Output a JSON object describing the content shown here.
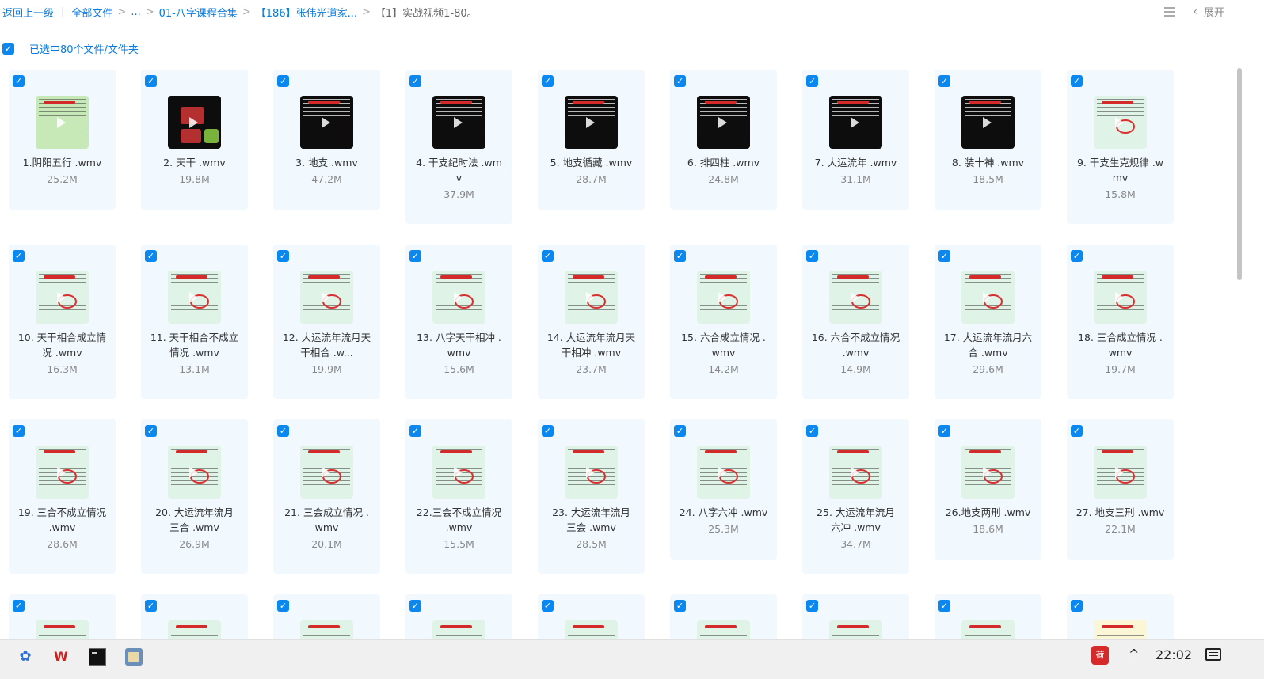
{
  "breadcrumb": {
    "back_label": "返回上一级",
    "items": [
      "全部文件",
      "...",
      "01-八字课程合集",
      "【186】张伟光道家...",
      "【1】实战视频1-80。"
    ],
    "separator": ">"
  },
  "topbar": {
    "expand_label": "展开",
    "list_view_icon": "list-view-icon",
    "collapse_icon": "chevron-left-icon"
  },
  "selection": {
    "label": "已选中80个文件/文件夹",
    "checked": true
  },
  "files": [
    {
      "name": "1.阴阳五行 .wmv",
      "size": "25.2M",
      "thumb": "greenbright"
    },
    {
      "name": "2. 天干 .wmv",
      "size": "19.8M",
      "thumb": "darkboxes"
    },
    {
      "name": "3. 地支 .wmv",
      "size": "47.2M",
      "thumb": "dark"
    },
    {
      "name": "4. 干支纪时法 .wmv",
      "size": "37.9M",
      "thumb": "dark"
    },
    {
      "name": "5. 地支循藏 .wmv",
      "size": "28.7M",
      "thumb": "dark"
    },
    {
      "name": "6. 排四柱 .wmv",
      "size": "24.8M",
      "thumb": "dark"
    },
    {
      "name": "7. 大运流年 .wmv",
      "size": "31.1M",
      "thumb": "dark"
    },
    {
      "name": "8. 装十神 .wmv",
      "size": "18.5M",
      "thumb": "dark"
    },
    {
      "name": "9. 干支生克规律 .wmv",
      "size": "15.8M",
      "thumb": "green"
    },
    {
      "name": "10. 天干相合成立情况 .wmv",
      "size": "16.3M",
      "thumb": "green"
    },
    {
      "name": "11. 天干相合不成立情况 .wmv",
      "size": "13.1M",
      "thumb": "green"
    },
    {
      "name": "12. 大运流年流月天干相合 .w...",
      "size": "19.9M",
      "thumb": "green"
    },
    {
      "name": "13. 八字天干相冲 .wmv",
      "size": "15.6M",
      "thumb": "green"
    },
    {
      "name": "14. 大运流年流月天干相冲 .wmv",
      "size": "23.7M",
      "thumb": "green"
    },
    {
      "name": "15. 六合成立情况 .wmv",
      "size": "14.2M",
      "thumb": "green"
    },
    {
      "name": "16. 六合不成立情况 .wmv",
      "size": "14.9M",
      "thumb": "green"
    },
    {
      "name": "17. 大运流年流月六合 .wmv",
      "size": "29.6M",
      "thumb": "green"
    },
    {
      "name": "18. 三合成立情况 .wmv",
      "size": "19.7M",
      "thumb": "green"
    },
    {
      "name": "19. 三合不成立情况 .wmv",
      "size": "28.6M",
      "thumb": "green"
    },
    {
      "name": "20. 大运流年流月三合 .wmv",
      "size": "26.9M",
      "thumb": "green"
    },
    {
      "name": "21. 三会成立情况 .wmv",
      "size": "20.1M",
      "thumb": "green"
    },
    {
      "name": "22.三会不成立情况 .wmv",
      "size": "15.5M",
      "thumb": "green"
    },
    {
      "name": "23. 大运流年流月三会 .wmv",
      "size": "28.5M",
      "thumb": "green"
    },
    {
      "name": "24. 八字六冲 .wmv",
      "size": "25.3M",
      "thumb": "green"
    },
    {
      "name": "25. 大运流年流月六冲 .wmv",
      "size": "34.7M",
      "thumb": "green"
    },
    {
      "name": "26.地支两刑 .wmv",
      "size": "18.6M",
      "thumb": "green"
    },
    {
      "name": "27. 地支三刑 .wmv",
      "size": "22.1M",
      "thumb": "green"
    },
    {
      "name": "",
      "size": "",
      "thumb": "green"
    },
    {
      "name": "",
      "size": "",
      "thumb": "green"
    },
    {
      "name": "",
      "size": "",
      "thumb": "green"
    },
    {
      "name": "",
      "size": "",
      "thumb": "green"
    },
    {
      "name": "",
      "size": "",
      "thumb": "green"
    },
    {
      "name": "",
      "size": "",
      "thumb": "green"
    },
    {
      "name": "",
      "size": "",
      "thumb": "green"
    },
    {
      "name": "",
      "size": "",
      "thumb": "green"
    },
    {
      "name": "",
      "size": "",
      "thumb": "yellow"
    }
  ],
  "name_lines": [
    [
      "1.阴阳五行 .wmv"
    ],
    [
      "2. 天干 .wmv"
    ],
    [
      "3. 地支 .wmv"
    ],
    [
      "4. 干支纪时法 .wm",
      "v"
    ],
    [
      "5. 地支循藏 .wmv"
    ],
    [
      "6. 排四柱 .wmv"
    ],
    [
      "7. 大运流年 .wmv"
    ],
    [
      "8. 装十神 .wmv"
    ],
    [
      "9. 干支生克规律 .w",
      "mv"
    ],
    [
      "10. 天干相合成立情",
      "况 .wmv"
    ],
    [
      "11. 天干相合不成立",
      "情况 .wmv"
    ],
    [
      "12. 大运流年流月天",
      "干相合 .w..."
    ],
    [
      "13. 八字天干相冲 .",
      "wmv"
    ],
    [
      "14. 大运流年流月天",
      "干相冲 .wmv"
    ],
    [
      "15. 六合成立情况 .",
      "wmv"
    ],
    [
      "16. 六合不成立情况",
      ".wmv"
    ],
    [
      "17. 大运流年流月六",
      "合 .wmv"
    ],
    [
      "18. 三合成立情况 .",
      "wmv"
    ],
    [
      "19. 三合不成立情况",
      ".wmv"
    ],
    [
      "20. 大运流年流月",
      "三合 .wmv"
    ],
    [
      "21. 三会成立情况 .",
      "wmv"
    ],
    [
      "22.三会不成立情况",
      ".wmv"
    ],
    [
      "23. 大运流年流月",
      "三会 .wmv"
    ],
    [
      "24. 八字六冲 .wmv"
    ],
    [
      "25. 大运流年流月",
      "六冲 .wmv"
    ],
    [
      "26.地支两刑 .wmv"
    ],
    [
      "27. 地支三刑 .wmv"
    ]
  ],
  "taskbar": {
    "apps": [
      "network-app-icon",
      "wps-icon",
      "terminal-icon",
      "file-manager-icon"
    ],
    "wps_label": "W",
    "ime_label": "荷",
    "up_arrow": "^",
    "clock": "22:02"
  }
}
